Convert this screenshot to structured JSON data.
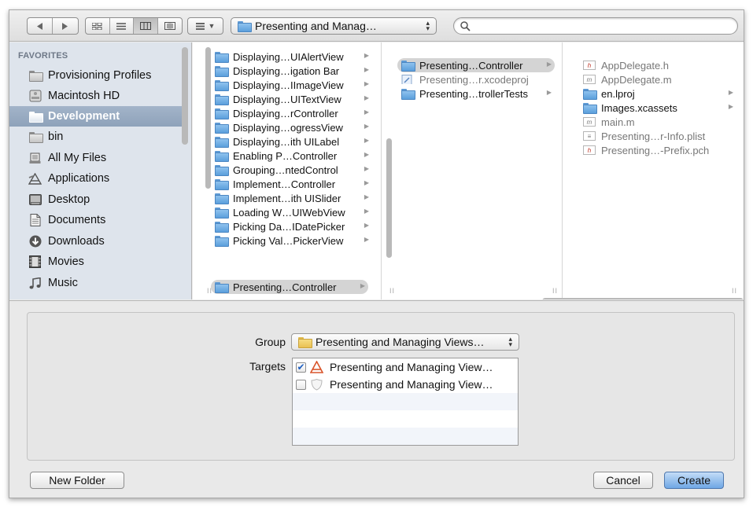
{
  "toolbar": {
    "path_label": "Presenting and Manag…",
    "search_placeholder": ""
  },
  "sidebar": {
    "heading": "FAVORITES",
    "items": [
      {
        "label": "Provisioning Profiles",
        "icon": "folder-icon"
      },
      {
        "label": "Macintosh HD",
        "icon": "hard-drive-icon"
      },
      {
        "label": "Development",
        "icon": "folder-icon",
        "selected": true
      },
      {
        "label": "bin",
        "icon": "folder-icon"
      },
      {
        "label": "All My Files",
        "icon": "all-files-icon"
      },
      {
        "label": "Applications",
        "icon": "applications-icon"
      },
      {
        "label": "Desktop",
        "icon": "desktop-icon"
      },
      {
        "label": "Documents",
        "icon": "documents-icon"
      },
      {
        "label": "Downloads",
        "icon": "downloads-icon"
      },
      {
        "label": "Movies",
        "icon": "movies-icon"
      },
      {
        "label": "Music",
        "icon": "music-icon"
      }
    ]
  },
  "columns": {
    "col1": [
      "Displaying…UIAlertView",
      "Displaying…igation Bar",
      "Displaying…IImageView",
      "Displaying…UITextView",
      "Displaying…rController",
      "Displaying…ogressView",
      "Displaying…ith UILabel",
      "Enabling P…Controller",
      "Grouping…ntedControl",
      "Implement…Controller",
      "Implement…ith UISlider",
      "Loading W…UIWebView",
      "Picking Da…IDatePicker",
      "Picking Val…PickerView",
      "Presenting…Controller"
    ],
    "col2": [
      "Presenting…Controller",
      "Presenting…r.xcodeproj",
      "Presenting…trollerTests"
    ],
    "col3": [
      "AppDelegate.h",
      "AppDelegate.m",
      "en.lproj",
      "Images.xcassets",
      "main.m",
      "Presenting…r-Info.plist",
      "Presenting…-Prefix.pch"
    ]
  },
  "form": {
    "group_label": "Group",
    "group_value": "Presenting and Managing Views…",
    "targets_label": "Targets",
    "targets": [
      {
        "label": "Presenting and Managing View…",
        "checked": true
      },
      {
        "label": "Presenting and Managing View…",
        "checked": false
      }
    ]
  },
  "buttons": {
    "new_folder": "New Folder",
    "cancel": "Cancel",
    "create": "Create"
  },
  "colors": {
    "sidebar_bg": "#dee4ec",
    "sidebar_selection": "#8ea2ba",
    "create_button": "#6fa7e5",
    "folder_blue": "#5b9fdc"
  }
}
